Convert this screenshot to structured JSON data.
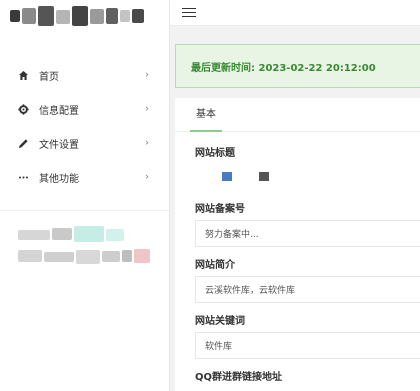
{
  "sidebar": {
    "items": [
      {
        "label": "首页",
        "icon": "home-icon",
        "chevron": "›"
      },
      {
        "label": "信息配置",
        "icon": "gear-icon",
        "chevron": "›"
      },
      {
        "label": "文件设置",
        "icon": "pencil-icon",
        "chevron": "›"
      },
      {
        "label": "其他功能",
        "icon": "more-icon",
        "chevron": "›"
      }
    ]
  },
  "header": {
    "menu_icon": "hamburger-icon"
  },
  "notice": {
    "text": "最后更新时间: 2023-02-22 20:12:00"
  },
  "tabs": [
    {
      "label": "基本"
    }
  ],
  "form": {
    "site_title": {
      "label": "网站标题"
    },
    "site_icp": {
      "label": "网站备案号",
      "value": "努力备案中..."
    },
    "site_intro": {
      "label": "网站简介",
      "value": "云溪软件库，云软件库"
    },
    "site_keywords": {
      "label": "网站关键词",
      "value": "软件库"
    },
    "qq_group": {
      "label": "QQ群进群链接地址"
    }
  },
  "colors": {
    "accent_green": "#3a8a34",
    "notice_bg": "#e8f5e4",
    "tab_underline": "#8ec995"
  }
}
